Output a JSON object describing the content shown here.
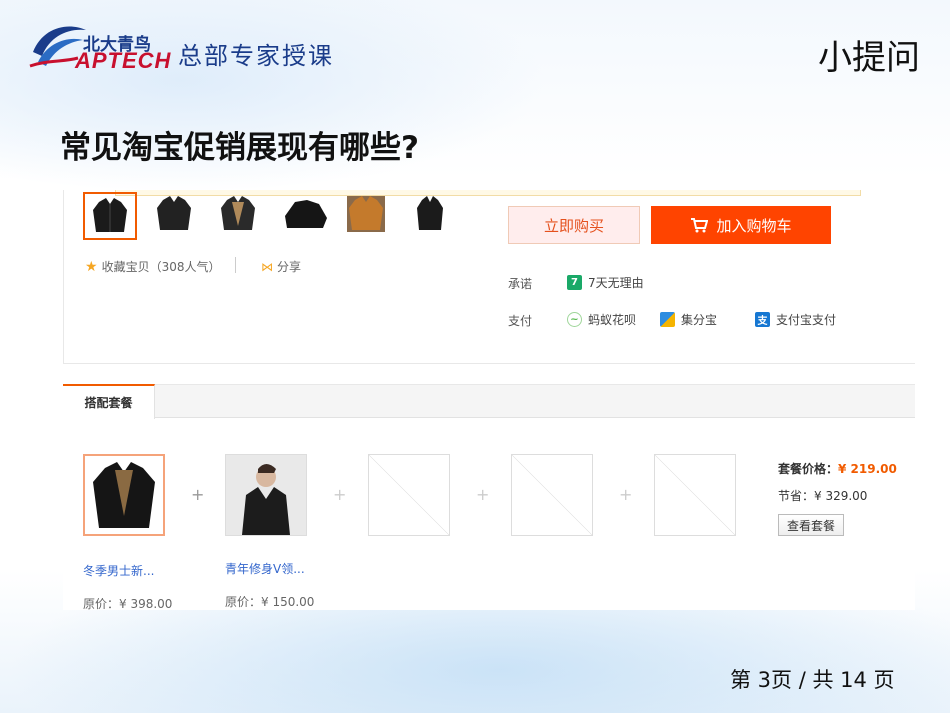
{
  "logo": {
    "cn": "北大青鸟",
    "en": "APTECH",
    "tagline": "总部专家授课"
  },
  "corner_title": "小提问",
  "question": "常见淘宝促销展现有哪些?",
  "product": {
    "favorite": "收藏宝贝（308人气）",
    "share": "分享",
    "buy_now": "立即购买",
    "add_cart": "加入购物车",
    "promise_label": "承诺",
    "promise_value": "7天无理由",
    "pay_label": "支付",
    "pay_methods": [
      "蚂蚁花呗",
      "集分宝",
      "支付宝支付"
    ]
  },
  "bundle": {
    "tab": "搭配套餐",
    "items": [
      {
        "name": "冬季男士新...",
        "price": "原价：¥ 398.00"
      },
      {
        "name": "青年修身V领...",
        "price": "原价：¥ 150.00"
      }
    ],
    "price_label": "套餐价格：",
    "price_value": "¥ 219.00",
    "save_label": "节省：¥ 329.00",
    "view_button": "查看套餐"
  },
  "page": "第 3页 / 共 14 页",
  "colors": {
    "accent": "#f15b00",
    "cart": "#ff4400",
    "link": "#3366cc"
  }
}
